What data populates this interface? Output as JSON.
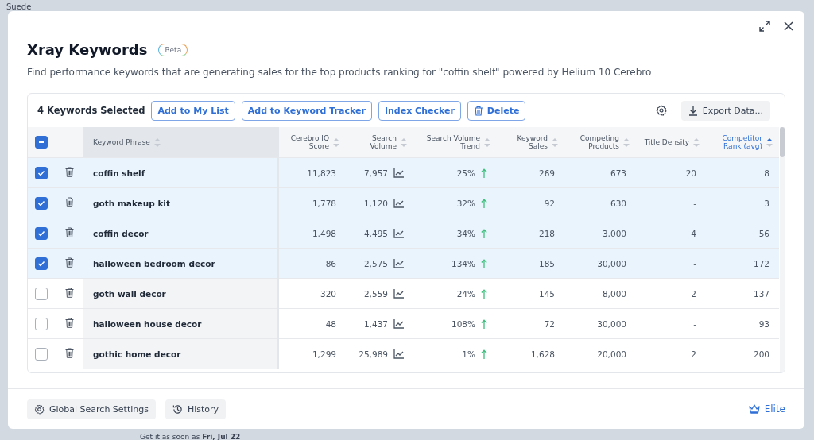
{
  "background_page": {
    "top_left": "Suede",
    "delivery": "Get it as soon as **Fri, Jul 22**"
  },
  "modal": {
    "title": "Xray Keywords",
    "badge": "Beta",
    "description": "Find performance keywords that are generating sales for the top products ranking for \"coffin shelf\" powered by Helium 10 Cerebro",
    "toolbar": {
      "selected_count": "4 Keywords Selected",
      "actions": [
        {
          "label": "Add to My List",
          "kind": "text"
        },
        {
          "label": "Add to Keyword Tracker",
          "kind": "text"
        },
        {
          "label": "Index Checker",
          "kind": "text"
        },
        {
          "label": "Delete",
          "kind": "delete"
        }
      ],
      "export": "Export Data..."
    },
    "table": {
      "select_all": {
        "checked": true,
        "partial": true
      },
      "columns": [
        {
          "label": "Keyword Phrase",
          "sorted": false
        },
        {
          "label": "Cerebro IQ Score",
          "sorted": false
        },
        {
          "label": "Search Volume",
          "sorted": false
        },
        {
          "label": "Search Volume Trend",
          "sorted": false
        },
        {
          "label": "Keyword Sales",
          "sorted": false
        },
        {
          "label": "Competing Products",
          "sorted": false
        },
        {
          "label": "Title Density",
          "sorted": false
        },
        {
          "label": "Competitor Rank (avg)",
          "sorted": true
        }
      ],
      "rows": [
        {
          "selected": true,
          "phrase": "coffin shelf",
          "iq": "11,823",
          "volume": "7,957",
          "trend": "25%",
          "sales": "269",
          "competing": "673",
          "density": "20",
          "rank": "8"
        },
        {
          "selected": true,
          "phrase": "goth makeup kit",
          "iq": "1,778",
          "volume": "1,120",
          "trend": "32%",
          "sales": "92",
          "competing": "630",
          "density": "-",
          "rank": "3"
        },
        {
          "selected": true,
          "phrase": "coffin decor",
          "iq": "1,498",
          "volume": "4,495",
          "trend": "34%",
          "sales": "218",
          "competing": "3,000",
          "density": "4",
          "rank": "56"
        },
        {
          "selected": true,
          "phrase": "halloween bedroom decor",
          "iq": "86",
          "volume": "2,575",
          "trend": "134%",
          "sales": "185",
          "competing": "30,000",
          "density": "-",
          "rank": "172"
        },
        {
          "selected": false,
          "phrase": "goth wall decor",
          "iq": "320",
          "volume": "2,559",
          "trend": "24%",
          "sales": "145",
          "competing": "8,000",
          "density": "2",
          "rank": "137"
        },
        {
          "selected": false,
          "phrase": "halloween house decor",
          "iq": "48",
          "volume": "1,437",
          "trend": "108%",
          "sales": "72",
          "competing": "30,000",
          "density": "-",
          "rank": "93"
        },
        {
          "selected": false,
          "phrase": "gothic home decor",
          "iq": "1,299",
          "volume": "25,989",
          "trend": "1%",
          "sales": "1,628",
          "competing": "20,000",
          "density": "2",
          "rank": "200"
        }
      ]
    },
    "footer": {
      "settings": "Global Search Settings",
      "history": "History",
      "plan": "Elite"
    }
  }
}
